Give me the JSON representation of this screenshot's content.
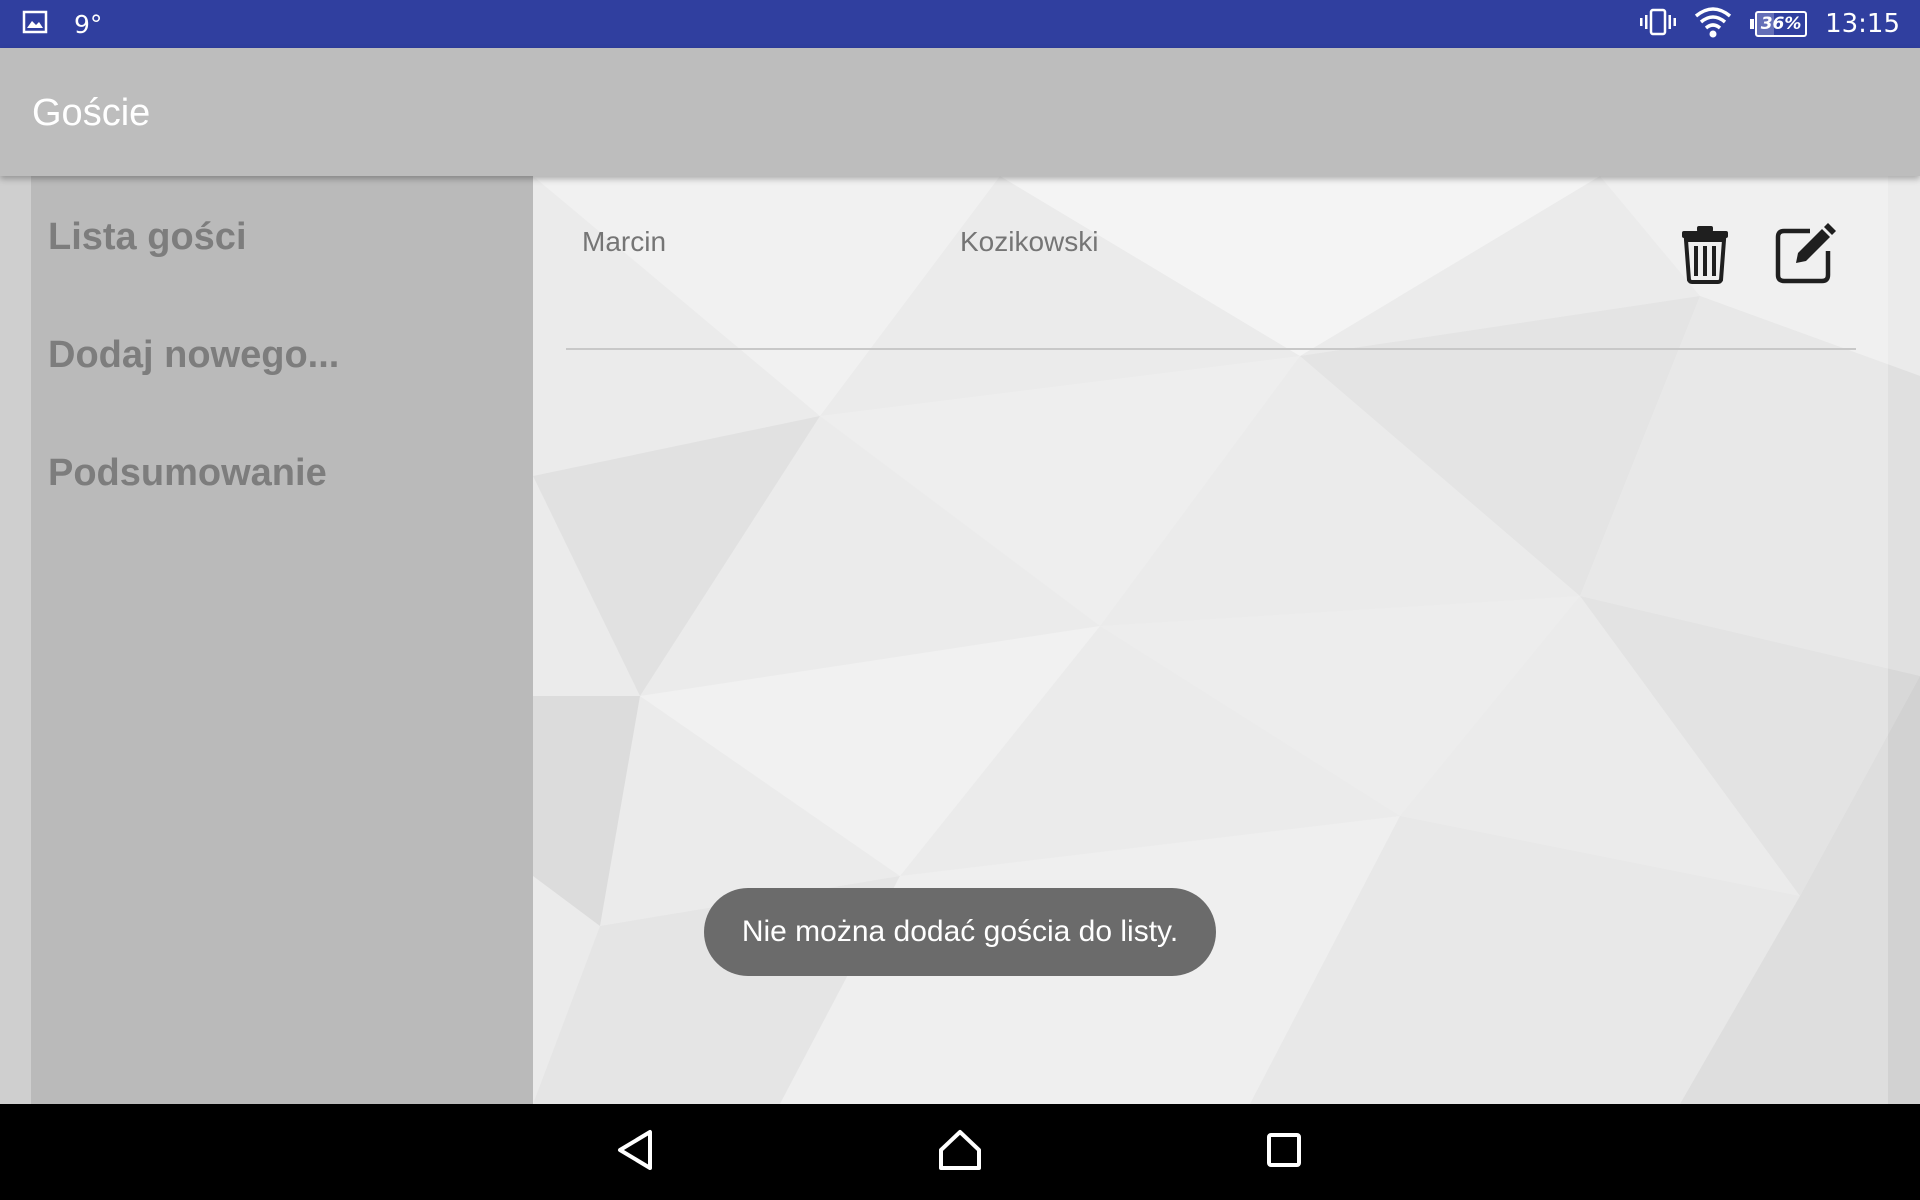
{
  "status_bar": {
    "notification_icon": "image-icon",
    "temperature": "9°",
    "vibrate_icon": "vibrate-icon",
    "wifi_icon": "wifi-icon",
    "battery_level": "36%",
    "battery_fraction": 0.36,
    "time": "13:15",
    "background_color": "#303f9f"
  },
  "app_bar": {
    "title": "Goście",
    "background_color": "#bdbdbd"
  },
  "sidebar": {
    "items": [
      {
        "label": "Lista gości"
      },
      {
        "label": "Dodaj nowego..."
      },
      {
        "label": "Podsumowanie"
      }
    ]
  },
  "guests": [
    {
      "first_name": "Marcin",
      "last_name": "Kozikowski",
      "delete_icon": "trash-icon",
      "edit_icon": "edit-icon"
    }
  ],
  "toast": {
    "message": "Nie można dodać gościa do listy."
  },
  "nav_bar": {
    "back_icon": "back-icon",
    "home_icon": "home-icon",
    "recents_icon": "recents-icon"
  }
}
